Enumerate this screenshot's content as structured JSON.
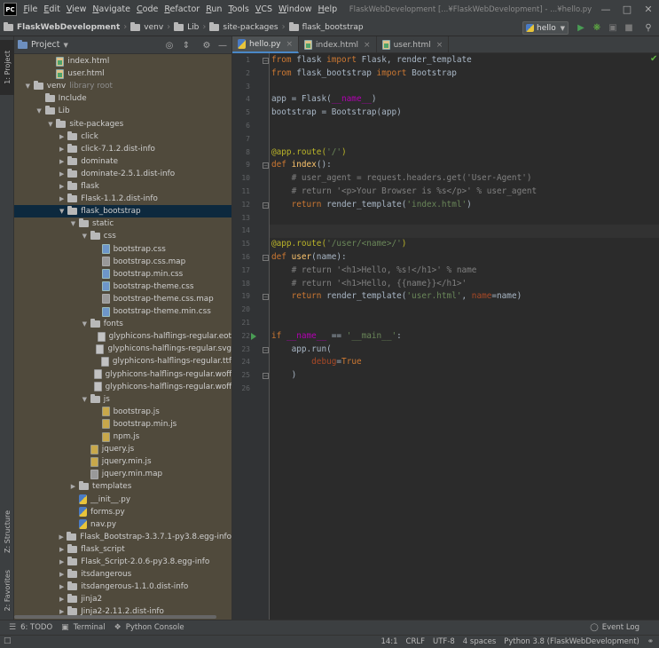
{
  "app": {
    "menus": [
      "File",
      "Edit",
      "View",
      "Navigate",
      "Code",
      "Refactor",
      "Run",
      "Tools",
      "VCS",
      "Window",
      "Help"
    ],
    "window_title": "FlaskWebDevelopment [...¥FlaskWebDevelopment] - ...¥hello.py",
    "logo_text": "PC"
  },
  "breadcrumbs": [
    "FlaskWebDevelopment",
    "venv",
    "Lib",
    "site-packages",
    "flask_bootstrap"
  ],
  "toolbar": {
    "run_config": "hello"
  },
  "left_strip": {
    "project_tab": "1: Project",
    "structure_tab": "Z: Structure",
    "favorites_tab": "2: Favorites"
  },
  "project_panel": {
    "title": "Project"
  },
  "tree": [
    {
      "indent": 3,
      "arrow": "",
      "icon": "html",
      "label": "index.html"
    },
    {
      "indent": 3,
      "arrow": "",
      "icon": "html",
      "label": "user.html"
    },
    {
      "indent": 1,
      "arrow": "down",
      "icon": "folder",
      "label": "venv",
      "hint": "library root"
    },
    {
      "indent": 2,
      "arrow": "",
      "icon": "folder",
      "label": "Include"
    },
    {
      "indent": 2,
      "arrow": "down",
      "icon": "folder",
      "label": "Lib"
    },
    {
      "indent": 3,
      "arrow": "down",
      "icon": "folder",
      "label": "site-packages"
    },
    {
      "indent": 4,
      "arrow": "right",
      "icon": "folder",
      "label": "click"
    },
    {
      "indent": 4,
      "arrow": "right",
      "icon": "folder",
      "label": "click-7.1.2.dist-info"
    },
    {
      "indent": 4,
      "arrow": "right",
      "icon": "folder",
      "label": "dominate"
    },
    {
      "indent": 4,
      "arrow": "right",
      "icon": "folder",
      "label": "dominate-2.5.1.dist-info"
    },
    {
      "indent": 4,
      "arrow": "right",
      "icon": "folder",
      "label": "flask"
    },
    {
      "indent": 4,
      "arrow": "right",
      "icon": "folder",
      "label": "Flask-1.1.2.dist-info"
    },
    {
      "indent": 4,
      "arrow": "down",
      "icon": "folder",
      "label": "flask_bootstrap",
      "selected": true
    },
    {
      "indent": 5,
      "arrow": "down",
      "icon": "folder",
      "label": "static"
    },
    {
      "indent": 6,
      "arrow": "down",
      "icon": "folder",
      "label": "css"
    },
    {
      "indent": 7,
      "arrow": "",
      "icon": "css",
      "label": "bootstrap.css"
    },
    {
      "indent": 7,
      "arrow": "",
      "icon": "map",
      "label": "bootstrap.css.map"
    },
    {
      "indent": 7,
      "arrow": "",
      "icon": "css",
      "label": "bootstrap.min.css"
    },
    {
      "indent": 7,
      "arrow": "",
      "icon": "css",
      "label": "bootstrap-theme.css"
    },
    {
      "indent": 7,
      "arrow": "",
      "icon": "map",
      "label": "bootstrap-theme.css.map"
    },
    {
      "indent": 7,
      "arrow": "",
      "icon": "css",
      "label": "bootstrap-theme.min.css"
    },
    {
      "indent": 6,
      "arrow": "down",
      "icon": "folder",
      "label": "fonts"
    },
    {
      "indent": 7,
      "arrow": "",
      "icon": "font",
      "label": "glyphicons-halflings-regular.eot"
    },
    {
      "indent": 7,
      "arrow": "",
      "icon": "font",
      "label": "glyphicons-halflings-regular.svg"
    },
    {
      "indent": 7,
      "arrow": "",
      "icon": "font",
      "label": "glyphicons-halflings-regular.ttf"
    },
    {
      "indent": 7,
      "arrow": "",
      "icon": "font",
      "label": "glyphicons-halflings-regular.woff"
    },
    {
      "indent": 7,
      "arrow": "",
      "icon": "font",
      "label": "glyphicons-halflings-regular.woff2"
    },
    {
      "indent": 6,
      "arrow": "down",
      "icon": "folder",
      "label": "js"
    },
    {
      "indent": 7,
      "arrow": "",
      "icon": "js",
      "label": "bootstrap.js"
    },
    {
      "indent": 7,
      "arrow": "",
      "icon": "js",
      "label": "bootstrap.min.js"
    },
    {
      "indent": 7,
      "arrow": "",
      "icon": "js",
      "label": "npm.js"
    },
    {
      "indent": 6,
      "arrow": "",
      "icon": "js",
      "label": "jquery.js"
    },
    {
      "indent": 6,
      "arrow": "",
      "icon": "js",
      "label": "jquery.min.js"
    },
    {
      "indent": 6,
      "arrow": "",
      "icon": "map",
      "label": "jquery.min.map"
    },
    {
      "indent": 5,
      "arrow": "right",
      "icon": "folder",
      "label": "templates"
    },
    {
      "indent": 5,
      "arrow": "",
      "icon": "py",
      "label": "__init__.py"
    },
    {
      "indent": 5,
      "arrow": "",
      "icon": "py",
      "label": "forms.py"
    },
    {
      "indent": 5,
      "arrow": "",
      "icon": "py",
      "label": "nav.py"
    },
    {
      "indent": 4,
      "arrow": "right",
      "icon": "folder",
      "label": "Flask_Bootstrap-3.3.7.1-py3.8.egg-info"
    },
    {
      "indent": 4,
      "arrow": "right",
      "icon": "folder",
      "label": "flask_script"
    },
    {
      "indent": 4,
      "arrow": "right",
      "icon": "folder",
      "label": "Flask_Script-2.0.6-py3.8.egg-info"
    },
    {
      "indent": 4,
      "arrow": "right",
      "icon": "folder",
      "label": "itsdangerous"
    },
    {
      "indent": 4,
      "arrow": "right",
      "icon": "folder",
      "label": "itsdangerous-1.1.0.dist-info"
    },
    {
      "indent": 4,
      "arrow": "right",
      "icon": "folder",
      "label": "jinja2"
    },
    {
      "indent": 4,
      "arrow": "right",
      "icon": "folder",
      "label": "Jinja2-2.11.2.dist-info"
    }
  ],
  "tabs": [
    {
      "label": "hello.py",
      "icon": "py",
      "active": true
    },
    {
      "label": "index.html",
      "icon": "html",
      "active": false
    },
    {
      "label": "user.html",
      "icon": "html",
      "active": false
    }
  ],
  "code_lines": [
    [
      [
        "kw",
        "from "
      ],
      [
        "",
        "flask "
      ],
      [
        "kw",
        "import "
      ],
      [
        "",
        "Flask, render_template"
      ]
    ],
    [
      [
        "kw",
        "from "
      ],
      [
        "",
        "flask_bootstrap "
      ],
      [
        "kw",
        "import "
      ],
      [
        "",
        "Bootstrap"
      ]
    ],
    [],
    [
      [
        "",
        "app = Flask("
      ],
      [
        "dunder",
        "__name__"
      ],
      [
        "",
        ")"
      ]
    ],
    [
      [
        "",
        "bootstrap = Bootstrap(app)"
      ]
    ],
    [],
    [],
    [
      [
        "dec",
        "@app.route("
      ],
      [
        "str",
        "'/'"
      ],
      [
        "dec",
        ")"
      ]
    ],
    [
      [
        "kw",
        "def "
      ],
      [
        "fn",
        "index"
      ],
      [
        "",
        "():"
      ]
    ],
    [
      [
        "cmt",
        "    # user_agent = request.headers.get('User-Agent')"
      ]
    ],
    [
      [
        "cmt",
        "    # return '<p>Your Browser is %s</p>' % user_agent"
      ]
    ],
    [
      [
        "",
        "    "
      ],
      [
        "kw",
        "return "
      ],
      [
        "",
        "render_template("
      ],
      [
        "str",
        "'index.html'"
      ],
      [
        "",
        ")"
      ]
    ],
    [],
    [],
    [
      [
        "dec",
        "@app.route("
      ],
      [
        "str",
        "'/user/<name>/'"
      ],
      [
        "dec",
        ")"
      ]
    ],
    [
      [
        "kw",
        "def "
      ],
      [
        "fn",
        "user"
      ],
      [
        "",
        "(name):"
      ]
    ],
    [
      [
        "cmt",
        "    # return '<h1>Hello, %s!</h1>' % name"
      ]
    ],
    [
      [
        "cmt",
        "    # return '<h1>Hello, {{name}}</h1>'"
      ]
    ],
    [
      [
        "",
        "    "
      ],
      [
        "kw",
        "return "
      ],
      [
        "",
        "render_template("
      ],
      [
        "str",
        "'user.html'"
      ],
      [
        "",
        ", "
      ],
      [
        "kwarg",
        "name"
      ],
      [
        "",
        "=name)"
      ]
    ],
    [],
    [],
    [
      [
        "kw",
        "if "
      ],
      [
        "dunder",
        "__name__"
      ],
      [
        "",
        " == "
      ],
      [
        "str",
        "'__main__'"
      ],
      [
        "",
        ":"
      ]
    ],
    [
      [
        "",
        "    app.run("
      ]
    ],
    [
      [
        "",
        "        "
      ],
      [
        "kwarg",
        "debug"
      ],
      [
        "",
        "="
      ],
      [
        "kw",
        "True"
      ]
    ],
    [
      [
        "",
        "    )"
      ]
    ],
    []
  ],
  "bottom_tabs": [
    {
      "label": "6: TODO",
      "icon": "list-icon"
    },
    {
      "label": "Terminal",
      "icon": "terminal-icon"
    },
    {
      "label": "Python Console",
      "icon": "python-icon"
    }
  ],
  "event_log": "Event Log",
  "status": {
    "position": "14:1",
    "line_sep": "CRLF",
    "encoding": "UTF-8",
    "indent": "4 spaces",
    "interpreter": "Python 3.8 (FlaskWebDevelopment)"
  },
  "colors": {
    "selection": "#0d293e",
    "project_bg": "#504a3c",
    "editor_bg": "#2b2b2b",
    "run_green": "#499c54"
  }
}
